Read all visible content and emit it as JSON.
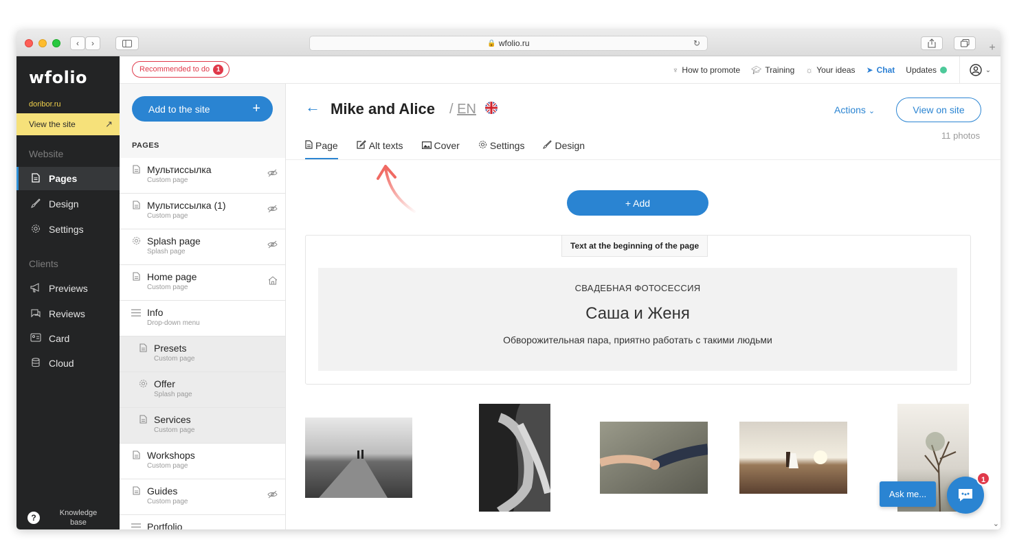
{
  "browser": {
    "url": "wfolio.ru",
    "lock_icon": "lock-icon",
    "back_label": "‹",
    "forward_label": "›"
  },
  "sidebar": {
    "brand": "wfolio",
    "domain": "doribor.ru",
    "view_site": "View the site",
    "website_label": "Website",
    "clients_label": "Clients",
    "nav_website": [
      {
        "label": "Pages",
        "icon": "page-icon"
      },
      {
        "label": "Design",
        "icon": "brush-icon"
      },
      {
        "label": "Settings",
        "icon": "gear-icon"
      }
    ],
    "nav_clients": [
      {
        "label": "Previews",
        "icon": "megaphone-icon"
      },
      {
        "label": "Reviews",
        "icon": "chat-icon"
      },
      {
        "label": "Card",
        "icon": "card-icon"
      },
      {
        "label": "Cloud",
        "icon": "database-icon"
      }
    ],
    "knowledge": "Knowledge base"
  },
  "topbar": {
    "recommended": "Recommended to do",
    "recommended_count": "1",
    "links": {
      "promote": "How to promote",
      "training": "Training",
      "ideas": "Your ideas",
      "chat": "Chat",
      "updates": "Updates"
    }
  },
  "pages_panel": {
    "add_button": "Add to the site",
    "heading": "PAGES",
    "items": [
      {
        "title": "Мультиссылка",
        "sub": "Custom page",
        "icon": "page-icon",
        "right": "hidden-icon",
        "child": false
      },
      {
        "title": "Мультиссылка (1)",
        "sub": "Custom page",
        "icon": "page-icon",
        "right": "hidden-icon",
        "child": false
      },
      {
        "title": "Splash page",
        "sub": "Splash page",
        "icon": "gear-icon",
        "right": "hidden-icon",
        "child": false
      },
      {
        "title": "Home page",
        "sub": "Custom page",
        "icon": "page-icon",
        "right": "home-icon",
        "child": false
      },
      {
        "title": "Info",
        "sub": "Drop-down menu",
        "icon": "menu-icon",
        "right": "",
        "child": false
      },
      {
        "title": "Presets",
        "sub": "Custom page",
        "icon": "page-icon",
        "right": "",
        "child": true
      },
      {
        "title": "Offer",
        "sub": "Splash page",
        "icon": "gear-icon",
        "right": "",
        "child": true
      },
      {
        "title": "Services",
        "sub": "Custom page",
        "icon": "page-icon",
        "right": "",
        "child": true
      },
      {
        "title": "Workshops",
        "sub": "Custom page",
        "icon": "page-icon",
        "right": "",
        "child": false
      },
      {
        "title": "Guides",
        "sub": "Custom page",
        "icon": "page-icon",
        "right": "hidden-icon",
        "child": false
      },
      {
        "title": "Portfolio",
        "sub": "",
        "icon": "menu-icon",
        "right": "",
        "child": false
      }
    ]
  },
  "main": {
    "title": "Mike and Alice",
    "lang_sep": "/",
    "lang": "EN",
    "actions": "Actions",
    "view_on_site": "View on site",
    "photo_count": "11 photos",
    "tabs": [
      {
        "label": "Page",
        "icon": "page-icon",
        "active": true
      },
      {
        "label": "Alt texts",
        "icon": "edit-icon",
        "active": false
      },
      {
        "label": "Cover",
        "icon": "image-icon",
        "active": false
      },
      {
        "label": "Settings",
        "icon": "gear-icon",
        "active": false
      },
      {
        "label": "Design",
        "icon": "brush-icon",
        "active": false
      }
    ],
    "add_button": "+ Add",
    "text_block": {
      "label": "Text at the beginning of the page",
      "subtitle": "СВАДЕБНАЯ ФОТОСЕССИЯ",
      "title": "Саша и Женя",
      "description": "Обворожительная пара, приятно работать с такими людьми"
    },
    "ask_me": "Ask me...",
    "chat_badge": "1"
  },
  "colors": {
    "accent": "#2a84d2",
    "sidebar_bg": "#232425",
    "view_site_bg": "#f6e17a",
    "recommend_red": "#e0394a",
    "updates_dot": "#4dc99a"
  }
}
